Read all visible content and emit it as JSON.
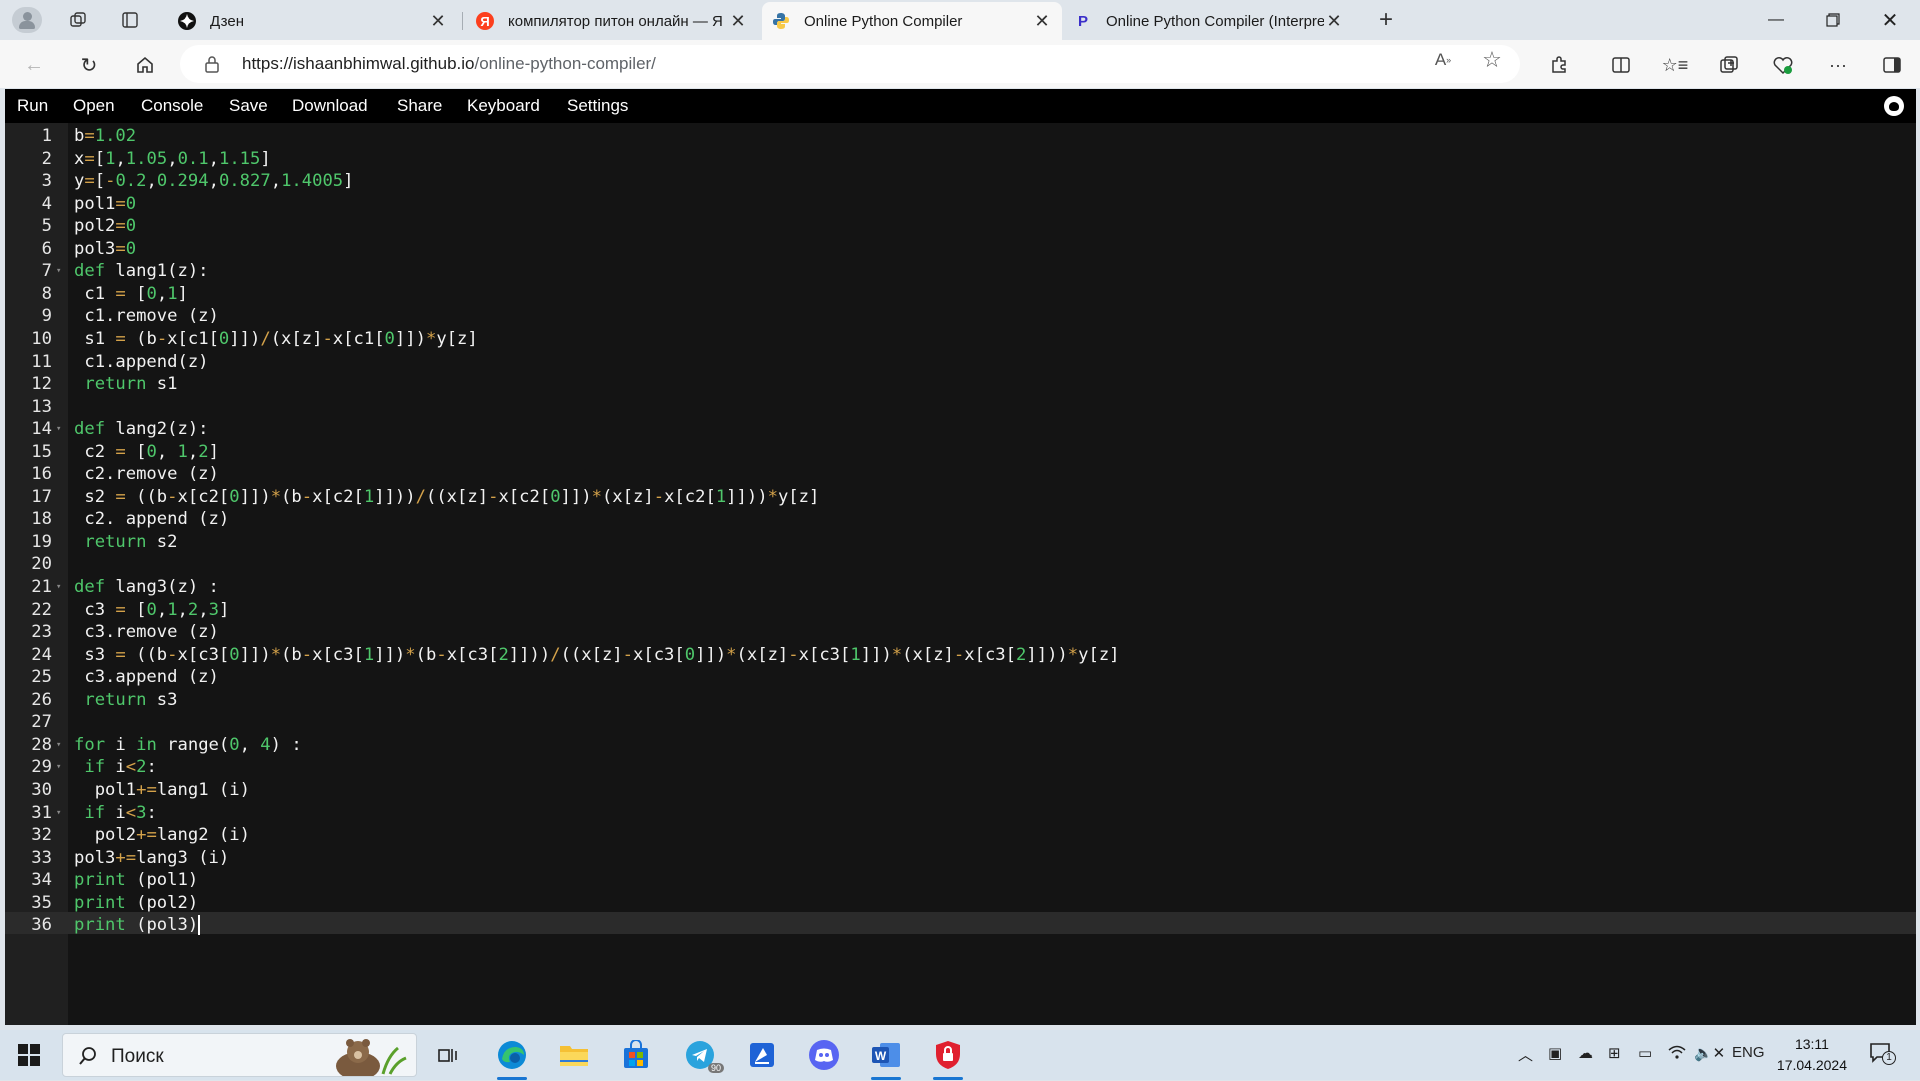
{
  "browser": {
    "tabs": [
      {
        "title": "Дзен",
        "favicon": "zen-icon",
        "active": false
      },
      {
        "title": "компилятор питон онлайн — Я",
        "favicon": "yandex-icon",
        "active": false
      },
      {
        "title": "Online Python Compiler",
        "favicon": "python-icon",
        "active": true
      },
      {
        "title": "Online Python Compiler (Interpre",
        "favicon": "programiz-icon",
        "active": false
      }
    ],
    "url_host": "https://ishaanbhimwal.github.io",
    "url_path": "/online-python-compiler/"
  },
  "menu": {
    "run": "Run",
    "open": "Open",
    "console": "Console",
    "save": "Save",
    "download": "Download",
    "share": "Share",
    "keyboard": "Keyboard",
    "settings": "Settings"
  },
  "code_lines": [
    "b=1.02",
    "x=[1,1.05,0.1,1.15]",
    "y=[-0.2,0.294,0.827,1.4005]",
    "pol1=0",
    "pol2=0",
    "pol3=0",
    "def lang1(z):",
    " c1 = [0,1]",
    " c1.remove (z)",
    " s1 = (b-x[c1[0]])/(x[z]-x[c1[0]])*y[z]",
    " c1.append(z)",
    " return s1",
    "",
    "def lang2(z):",
    " c2 = [0, 1,2]",
    " c2.remove (z)",
    " s2 = ((b-x[c2[0]])*(b-x[c2[1]]))/((x[z]-x[c2[0]])*(x[z]-x[c2[1]]))*y[z]",
    " c2. append (z)",
    " return s2",
    "",
    "def lang3(z) :",
    " c3 = [0,1,2,3]",
    " c3.remove (z)",
    " s3 = ((b-x[c3[0]])*(b-x[c3[1]])*(b-x[c3[2]]))/((x[z]-x[c3[0]])*(x[z]-x[c3[1]])*(x[z]-x[c3[2]]))*y[z]",
    " c3.append (z)",
    " return s3",
    "",
    "for i in range(0, 4) :",
    " if i<2:",
    "  pol1+=lang1 (i)",
    " if i<3:",
    "  pol2+=lang2 (i)",
    "pol3+=lang3 (i)",
    "print (pol1)",
    "print (pol2)",
    "print (pol3)"
  ],
  "fold_lines": [
    7,
    14,
    21,
    28,
    29,
    31
  ],
  "active_line": 36,
  "taskbar": {
    "search_placeholder": "Поиск",
    "telegram_badge": "90",
    "lang": "ENG",
    "time": "13:11",
    "date": "17.04.2024",
    "notifications": "1"
  }
}
